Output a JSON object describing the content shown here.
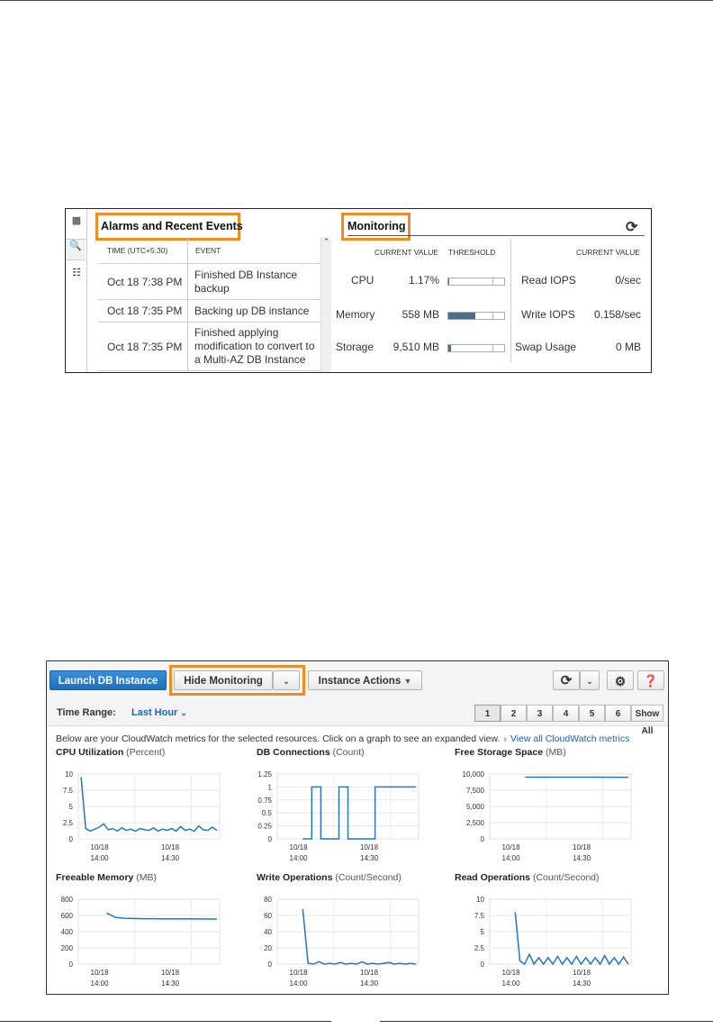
{
  "panel1": {
    "events_title": "Alarms and Recent Events",
    "monitoring_title": "Monitoring",
    "events_columns": [
      "TIME (UTC+5:30)",
      "EVENT"
    ],
    "events": [
      {
        "time": "Oct 18 7:38 PM",
        "event": "Finished DB Instance backup"
      },
      {
        "time": "Oct 18 7:35 PM",
        "event": "Backing up DB instance"
      },
      {
        "time": "Oct 18 7:35 PM",
        "event": "Finished applying modification to convert to a Multi-AZ DB Instance"
      }
    ],
    "monitoring_headers": {
      "current_value": "CURRENT VALUE",
      "threshold": "THRESHOLD",
      "current_value_right": "CURRENT VALUE"
    },
    "metrics_left": [
      {
        "name": "CPU",
        "value": "1.17%",
        "fill": 0.02
      },
      {
        "name": "Memory",
        "value": "558 MB",
        "fill": 0.48
      },
      {
        "name": "Storage",
        "value": "9,510 MB",
        "fill": 0.05
      }
    ],
    "metrics_right": [
      {
        "name": "Read IOPS",
        "value": "0/sec"
      },
      {
        "name": "Write IOPS",
        "value": "0.158/sec"
      },
      {
        "name": "Swap Usage",
        "value": "0 MB"
      }
    ]
  },
  "panel2": {
    "toolbar": {
      "launch_label": "Launch DB Instance",
      "hide_monitoring_label": "Hide Monitoring",
      "instance_actions_label": "Instance Actions"
    },
    "time_range_label": "Time Range:",
    "time_range_value": "Last Hour",
    "pages": [
      "1",
      "2",
      "3",
      "4",
      "5",
      "6"
    ],
    "show_all_label": "Show All",
    "intro_text": "Below are your CloudWatch metrics for the selected resources. Click on a graph to see an expanded view.",
    "view_all_link": "View all CloudWatch metrics"
  },
  "chart_data": [
    {
      "type": "line",
      "title": "CPU Utilization",
      "unit": "(Percent)",
      "yticks": [
        "10",
        "7.5",
        "5",
        "2.5",
        "0"
      ],
      "ylim": [
        0,
        10
      ],
      "xticks": [
        "10/18\n14:00",
        "10/18\n14:30"
      ],
      "values": [
        9.5,
        1.6,
        1.2,
        1.5,
        1.8,
        2.3,
        1.4,
        1.6,
        1.2,
        1.7,
        1.3,
        1.5,
        1.2,
        1.6,
        1.4,
        1.3,
        1.7,
        1.2,
        1.5,
        1.3,
        1.6,
        1.2,
        1.9,
        1.3,
        1.5,
        1.2,
        2.0,
        1.4,
        1.3,
        1.8,
        1.3
      ]
    },
    {
      "type": "line",
      "title": "DB Connections",
      "unit": "(Count)",
      "yticks": [
        "1.25",
        "1",
        "0.75",
        "0.5",
        "0.25",
        "0"
      ],
      "ylim": [
        0,
        1.25
      ],
      "xticks": [
        "10/18\n14:00",
        "10/18\n14:30"
      ],
      "values": [
        0,
        0,
        1,
        1,
        0,
        0,
        0,
        0,
        1,
        1,
        0,
        0,
        0,
        0,
        0,
        0,
        1,
        1,
        1,
        1,
        1,
        1,
        1,
        1,
        1,
        1
      ]
    },
    {
      "type": "line",
      "title": "Free Storage Space",
      "unit": "(MB)",
      "yticks": [
        "10,000",
        "7,500",
        "5,000",
        "2,500",
        "0"
      ],
      "ylim": [
        0,
        10000
      ],
      "xticks": [
        "10/18\n14:00",
        "10/18\n14:30"
      ],
      "values": [
        9520,
        9515,
        9512,
        9510,
        9510,
        9510,
        9508,
        9508,
        9506,
        9506,
        9505
      ]
    },
    {
      "type": "line",
      "title": "Freeable Memory",
      "unit": "(MB)",
      "yticks": [
        "800",
        "600",
        "400",
        "200",
        "0"
      ],
      "ylim": [
        0,
        800
      ],
      "xticks": [
        "10/18\n14:00",
        "10/18\n14:30"
      ],
      "values": [
        630,
        575,
        565,
        562,
        560,
        560,
        559,
        558,
        558,
        558,
        557,
        557,
        556
      ]
    },
    {
      "type": "line",
      "title": "Write Operations",
      "unit": "(Count/Second)",
      "yticks": [
        "80",
        "60",
        "40",
        "20",
        "0"
      ],
      "ylim": [
        0,
        80
      ],
      "xticks": [
        "10/18\n14:00",
        "10/18\n14:30"
      ],
      "values": [
        68,
        1,
        0,
        3,
        0,
        1,
        0,
        2,
        0,
        1,
        0,
        3,
        0,
        1,
        0,
        1,
        2,
        0,
        1,
        0,
        1,
        0
      ]
    },
    {
      "type": "line",
      "title": "Read Operations",
      "unit": "(Count/Second)",
      "yticks": [
        "10",
        "7.5",
        "5",
        "2.5",
        "0"
      ],
      "ylim": [
        0,
        10
      ],
      "xticks": [
        "10/18\n14:00",
        "10/18\n14:30"
      ],
      "values": [
        8,
        0.5,
        0,
        1.5,
        0,
        1,
        0,
        1,
        0,
        1.2,
        0,
        1,
        0,
        1.2,
        0,
        1,
        0,
        1,
        0,
        1.3,
        0,
        1,
        0,
        1.1,
        0
      ]
    }
  ]
}
